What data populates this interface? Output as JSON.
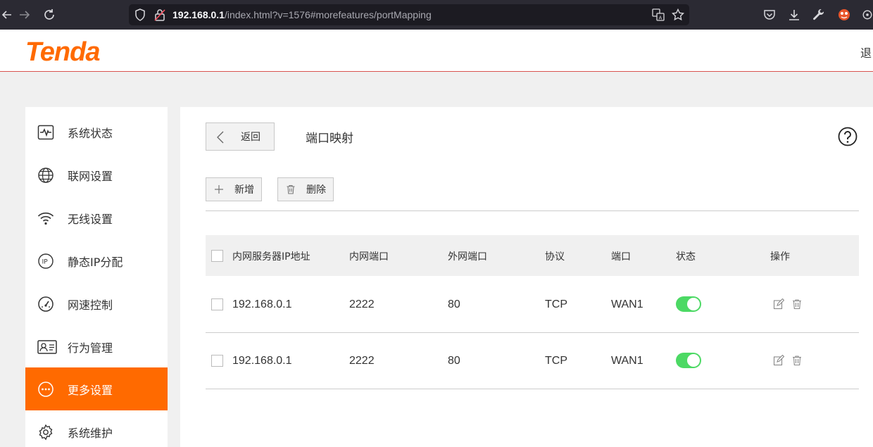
{
  "browser": {
    "url_host": "192.168.0.1",
    "url_path": "/index.html?v=1576#morefeatures/portMapping"
  },
  "header": {
    "logo_text": "Tenda",
    "logout_label": "退",
    "brand_color": "#ff6a00"
  },
  "sidebar": {
    "items": [
      {
        "label": "系统状态",
        "icon": "pulse-icon"
      },
      {
        "label": "联网设置",
        "icon": "globe-icon"
      },
      {
        "label": "无线设置",
        "icon": "wifi-icon"
      },
      {
        "label": "静态IP分配",
        "icon": "ip-icon"
      },
      {
        "label": "网速控制",
        "icon": "speedometer-icon"
      },
      {
        "label": "行为管理",
        "icon": "id-card-icon"
      },
      {
        "label": "更多设置",
        "icon": "more-icon",
        "active": true
      },
      {
        "label": "系统维护",
        "icon": "gear-icon"
      }
    ]
  },
  "main": {
    "back_label": "返回",
    "title": "端口映射",
    "add_label": "新增",
    "delete_label": "删除"
  },
  "table": {
    "headers": [
      "内网服务器IP地址",
      "内网端口",
      "外网端口",
      "协议",
      "端口",
      "状态",
      "操作"
    ],
    "rows": [
      {
        "ip": "192.168.0.1",
        "inner_port": "2222",
        "outer_port": "80",
        "protocol": "TCP",
        "port": "WAN1",
        "enabled": true
      },
      {
        "ip": "192.168.0.1",
        "inner_port": "2222",
        "outer_port": "80",
        "protocol": "TCP",
        "port": "WAN1",
        "enabled": true
      }
    ]
  },
  "colors": {
    "accent": "#ff6a00",
    "toggle_on": "#4cd964"
  }
}
